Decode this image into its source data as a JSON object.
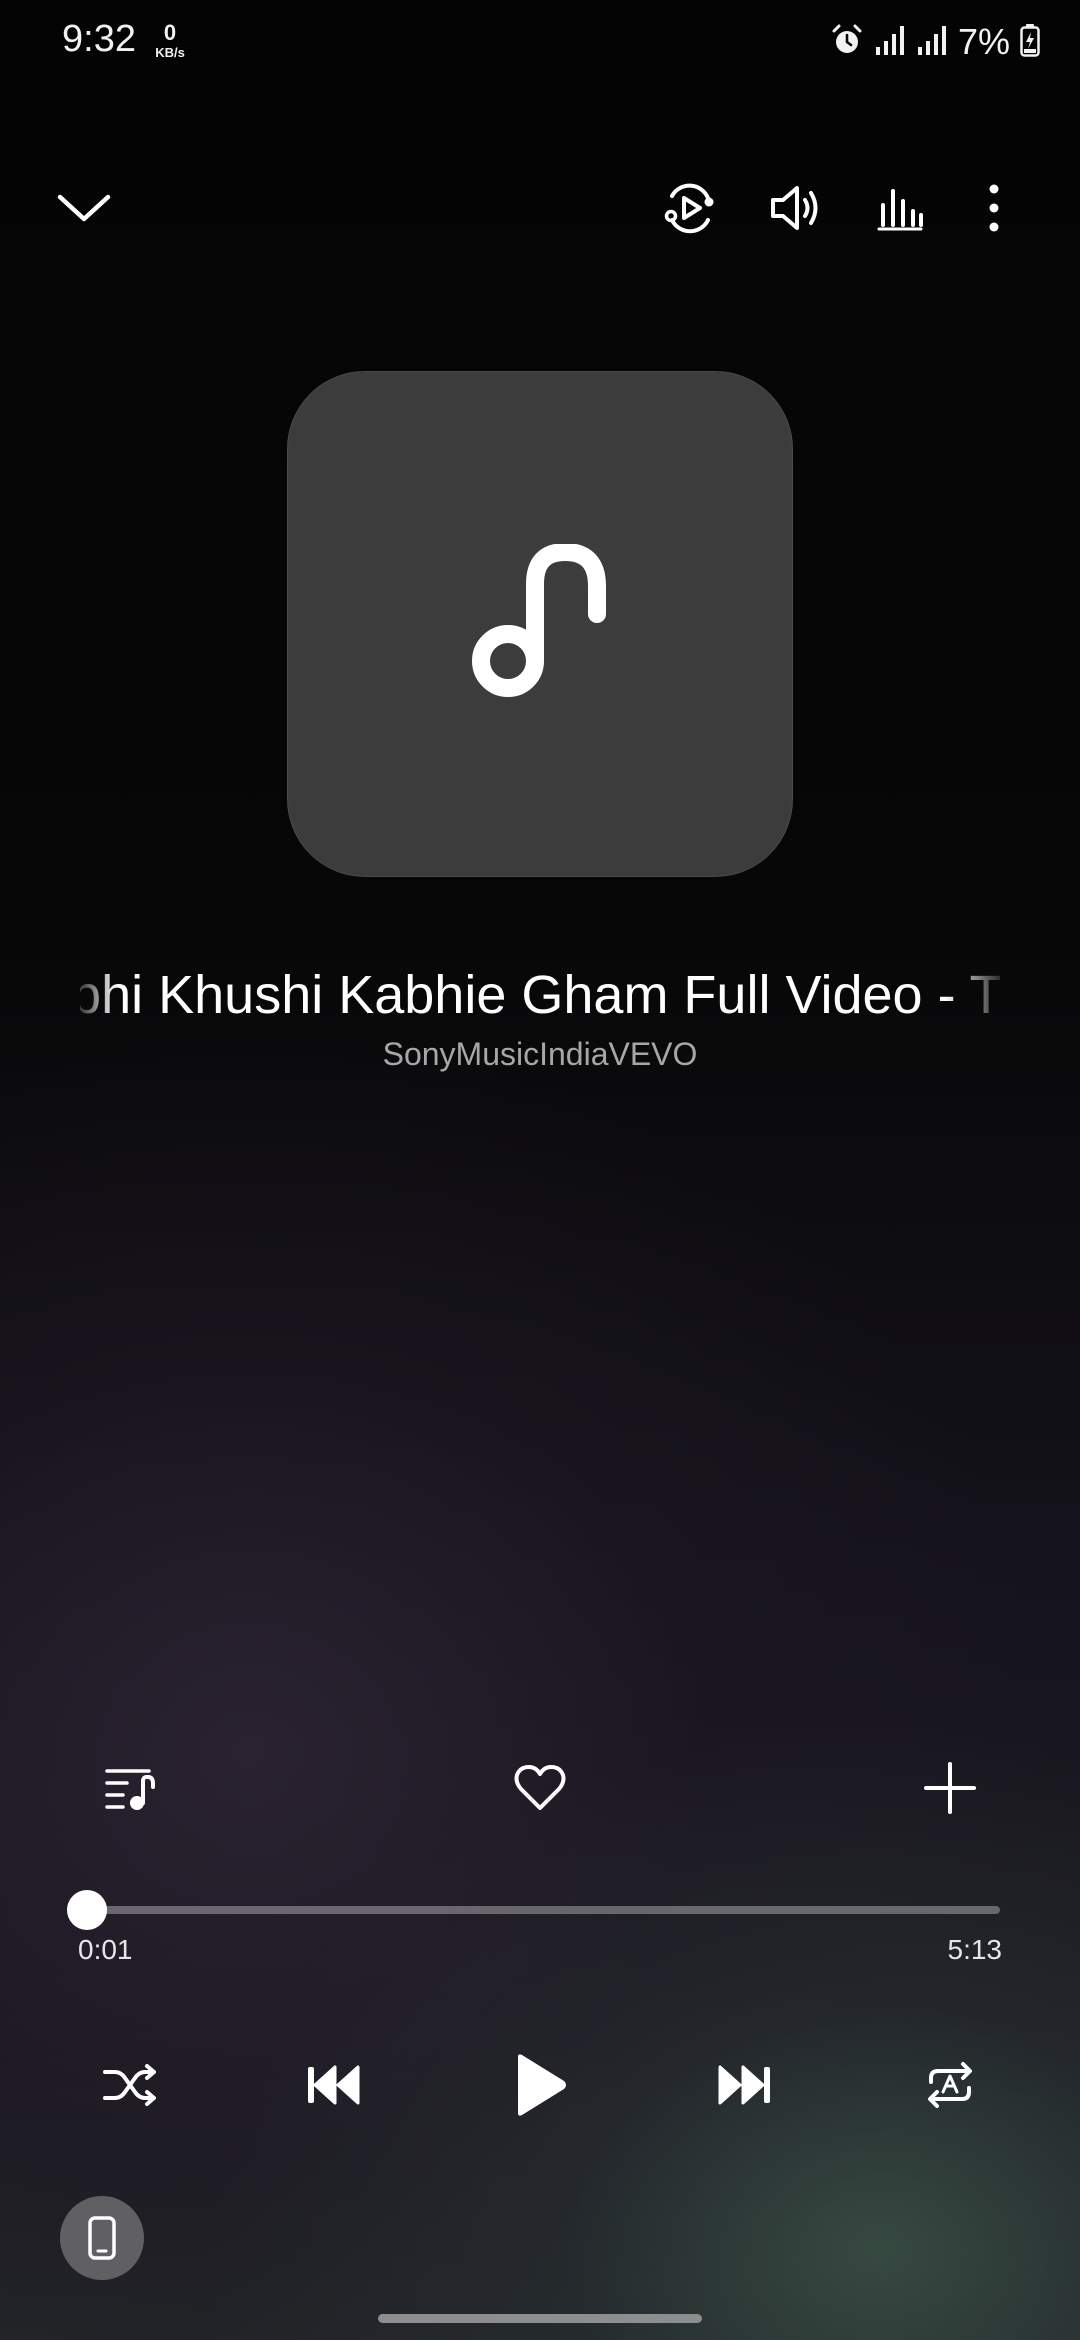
{
  "status_bar": {
    "time": "9:32",
    "net_speed_value": "0",
    "net_speed_unit": "KB/s",
    "battery": "7%",
    "icons": [
      "alarm-icon",
      "signal-icon",
      "signal-icon",
      "battery-charging-icon"
    ]
  },
  "toolbar": {
    "icons": [
      "chevron-down-icon",
      "smart-view-icon",
      "volume-icon",
      "equalizer-icon",
      "more-options-icon"
    ]
  },
  "album_art": {
    "icon": "music-note-icon"
  },
  "track": {
    "title": "Kabhi Khushi Kabhie Gham Full Video - Title Track",
    "artist": "SonyMusicIndiaVEVO"
  },
  "actions": {
    "icons": [
      "queue-icon",
      "heart-icon",
      "add-icon"
    ]
  },
  "progress": {
    "current": "0:01",
    "total": "5:13",
    "fraction": 0.003
  },
  "playback": {
    "icons": [
      "shuffle-icon",
      "previous-icon",
      "play-icon",
      "next-icon",
      "repeat-icon"
    ]
  },
  "colors": {
    "background": "#050505",
    "album_tile": "#3c3c3c",
    "text_primary": "#ffffff",
    "text_secondary": "#a7a7a7"
  }
}
